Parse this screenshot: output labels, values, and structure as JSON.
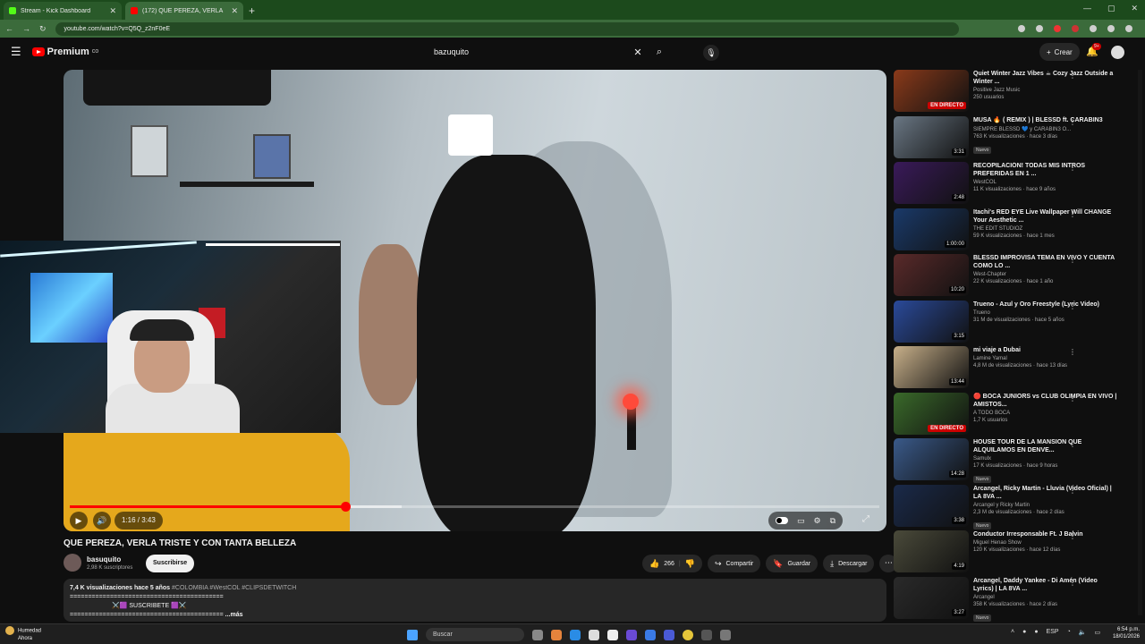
{
  "browser": {
    "tabs": [
      {
        "label": "Stream - Kick Dashboard",
        "favicon_color": "#53fc18"
      },
      {
        "label": "(172) QUE PEREZA, VERLA",
        "favicon_color": "#ff0000"
      }
    ],
    "url": "youtube.com/watch?v=Q5Q_z2nF0eE"
  },
  "header": {
    "logo_text": "Premium",
    "logo_badge": "CO",
    "search_value": "bazuquito",
    "create_label": "Crear",
    "notif_count": "9+"
  },
  "player": {
    "current_time": "1:16",
    "duration": "3:43",
    "time_display": "1:16 / 3:43",
    "progress_fraction": 0.34,
    "buffered_fraction": 0.41
  },
  "video": {
    "title": "QUE PEREZA, VERLA TRISTE Y CON TANTA BELLEZA",
    "channel": "basuquito",
    "subscribers": "2,98 K suscriptores",
    "subscribe_label": "Suscribirse",
    "likes": "266",
    "share_label": "Compartir",
    "save_label": "Guardar",
    "download_label": "Descargar"
  },
  "description": {
    "views": "7,4 K visualizaciones",
    "age": "hace 5 años",
    "tags": "#COLOMBIA #WestCOL #CLIPSDETWITCH",
    "line1": "==========================================",
    "line2": "⚔️🟪 SUSCRIBETE 🟪⚔️",
    "line3": "==========================================",
    "more_label": "...más"
  },
  "sidebar": [
    {
      "title": "Quiet Winter Jazz Vibes ☕ Cozy Jazz Outside a Winter ...",
      "channel": "Positive Jazz Music",
      "meta": "250 usuarios",
      "badge": "EN DIRECTO",
      "live": true,
      "color": "#8a3a1a"
    },
    {
      "title": "MUSA 🔥 ( REMIX ) | BLESSD ft. CARABIN3",
      "channel": "SIEMPRE BLESSD 💙 y CARABIN3 O...",
      "meta": "763 K visualizaciones · hace 3 días",
      "badge": "3:31",
      "new": "Nuevo",
      "color": "#6a7784"
    },
    {
      "title": "RECOPILACIÓN! TODAS MIS INTROS PREFERIDAS EN 1 ...",
      "channel": "WestCOL",
      "meta": "11 K visualizaciones · hace 9 años",
      "badge": "2:48",
      "color": "#3a1a5a"
    },
    {
      "title": "Itachi's RED EYE Live Wallpaper Will CHANGE Your Aesthetic ...",
      "channel": "THE EDIT STUDIOZ",
      "meta": "59 K visualizaciones · hace 1 mes",
      "badge": "1:00:00",
      "color": "#1a3a6a"
    },
    {
      "title": "BLESSD IMPROVISA TEMA EN VIVO Y CUENTA COMO LO ...",
      "channel": "West-Chapter",
      "meta": "22 K visualizaciones · hace 1 año",
      "badge": "10:20",
      "color": "#5a2a2a"
    },
    {
      "title": "Trueno - Azul y Oro Freestyle (Lyric Video)",
      "channel": "Trueno",
      "meta": "31 M de visualizaciones · hace 5 años",
      "badge": "3:15",
      "color": "#2a4a9a"
    },
    {
      "title": "mi viaje a Dubai",
      "channel": "Lamine Yamal",
      "meta": "4,8 M de visualizaciones · hace 13 días",
      "badge": "13:44",
      "color": "#c8b08a"
    },
    {
      "title": "🔴 BOCA JUNIORS vs CLUB OLIMPIA EN VIVO | AMISTOS...",
      "channel": "A TODO BOCA",
      "meta": "1,7 K usuarios",
      "badge": "EN DIRECTO",
      "live": true,
      "color": "#3a6a2a"
    },
    {
      "title": "HOUSE TOUR DE LA MANSION QUE ALQUILAMOS EN DENVE...",
      "channel": "Samulx",
      "meta": "17 K visualizaciones · hace 9 horas",
      "badge": "14:28",
      "new": "Nuevo",
      "color": "#3a5a8a"
    },
    {
      "title": "Arcangel, Ricky Martin - Lluvia (Video Oficial) | LA 8VA ...",
      "channel": "Arcangel y Ricky Martin",
      "meta": "2,3 M de visualizaciones · hace 2 días",
      "badge": "3:38",
      "new": "Nuevo",
      "color": "#1a2a4a"
    },
    {
      "title": "Conductor Irresponsable Ft. J Balvin",
      "channel": "Miguel Henao Show",
      "meta": "120 K visualizaciones · hace 12 días",
      "badge": "4:19",
      "color": "#4a4a3a"
    },
    {
      "title": "Arcangel, Daddy Yankee - Di Amén (Video Lyrics) | LA 8VA ...",
      "channel": "Arcangel",
      "meta": "358 K visualizaciones · hace 2 días",
      "badge": "3:27",
      "new": "Nuevo",
      "color": "#2a2a2a"
    }
  ],
  "taskbar": {
    "weather_label": "Humedad",
    "weather_sub": "Ahora",
    "search_label": "Buscar",
    "lang": "ESP",
    "time": "6:54 p.m.",
    "date": "18/01/2026"
  }
}
